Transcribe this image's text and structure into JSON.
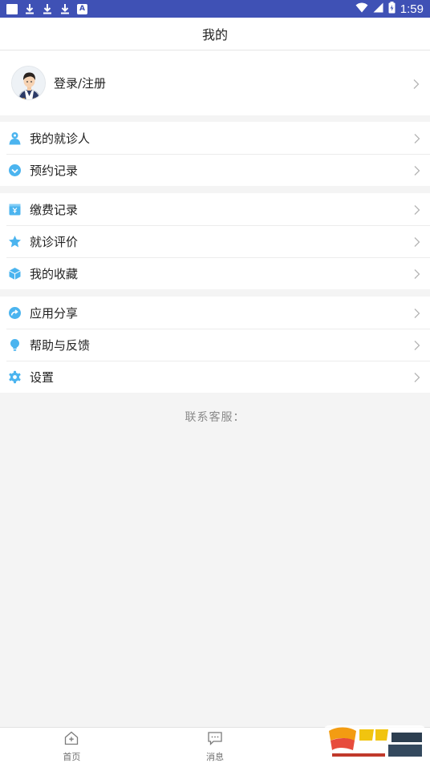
{
  "status_bar": {
    "time": "1:59"
  },
  "title": "我的",
  "profile": {
    "label": "登录/注册"
  },
  "groups": [
    {
      "items": [
        {
          "label": "我的就诊人",
          "icon": "person-icon"
        },
        {
          "label": "预约记录",
          "icon": "appointment-icon"
        }
      ]
    },
    {
      "items": [
        {
          "label": "缴费记录",
          "icon": "payment-icon"
        },
        {
          "label": "就诊评价",
          "icon": "star-icon"
        },
        {
          "label": "我的收藏",
          "icon": "box-icon"
        }
      ]
    },
    {
      "items": [
        {
          "label": "应用分享",
          "icon": "share-icon"
        },
        {
          "label": "帮助与反馈",
          "icon": "lightbulb-icon"
        },
        {
          "label": "设置",
          "icon": "gear-icon"
        }
      ]
    }
  ],
  "contact": {
    "label": "联系客服："
  },
  "bottom_nav": [
    {
      "label": "首页",
      "icon": "home-icon"
    },
    {
      "label": "消息",
      "icon": "message-icon"
    }
  ],
  "colors": {
    "status_bar": "#3f51b5",
    "icon_accent": "#4bb4ef",
    "background": "#f4f4f4"
  }
}
